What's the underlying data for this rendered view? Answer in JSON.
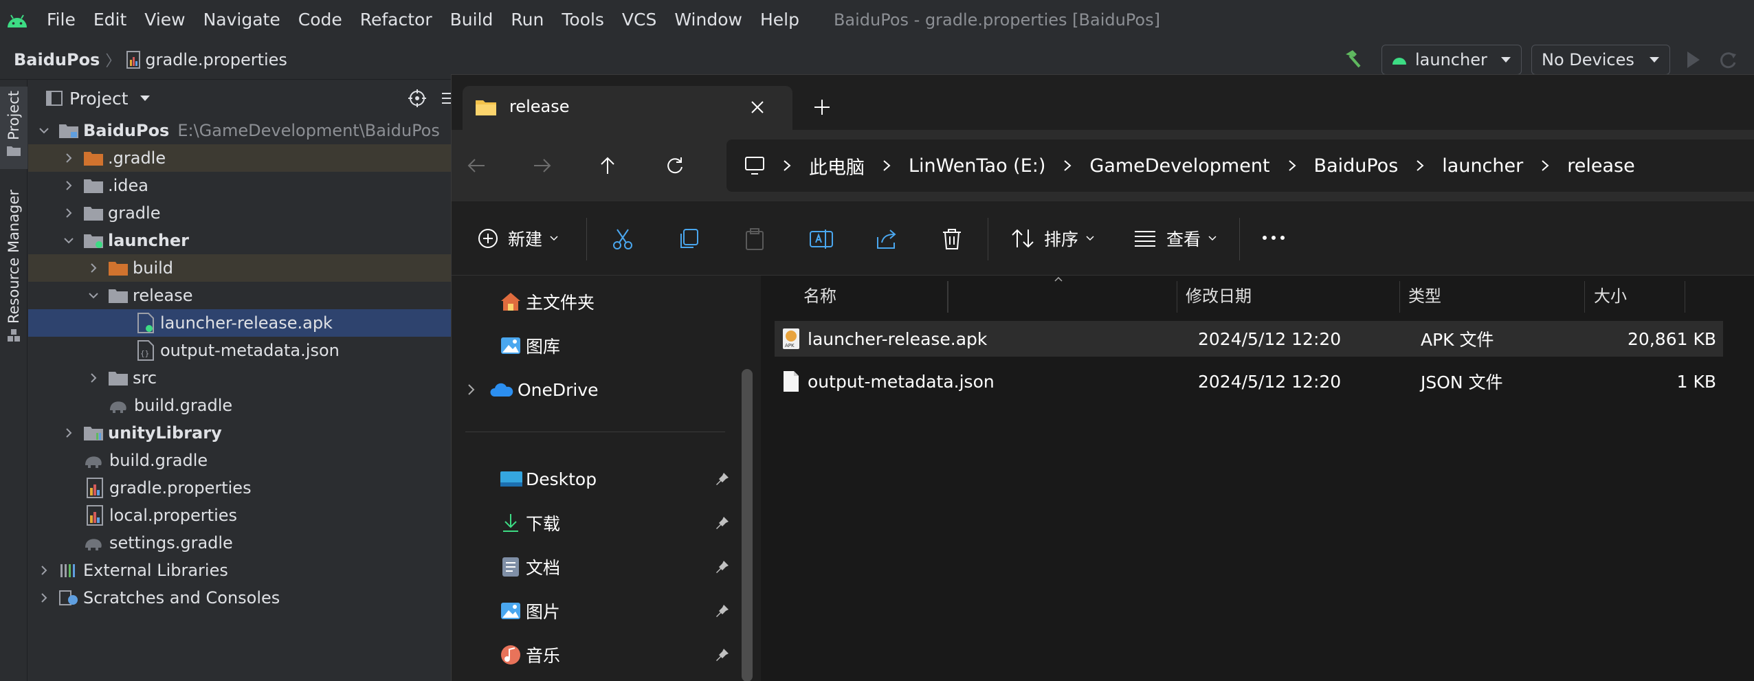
{
  "ide": {
    "title": "BaiduPos - gradle.properties [BaiduPos]",
    "menu": [
      "File",
      "Edit",
      "View",
      "Navigate",
      "Code",
      "Refactor",
      "Build",
      "Run",
      "Tools",
      "VCS",
      "Window",
      "Help"
    ],
    "breadcrumb": {
      "project": "BaiduPos",
      "file": "gradle.properties"
    },
    "run_config": "launcher",
    "device": "No Devices",
    "toolstrip": {
      "project": "Project",
      "resource_manager": "Resource Manager"
    },
    "project_panel": {
      "title": "Project",
      "tree": [
        {
          "label": "BaiduPos",
          "extra": "E:\\GameDevelopment\\BaiduPos",
          "bold": true
        },
        {
          "label": ".gradle"
        },
        {
          "label": ".idea"
        },
        {
          "label": "gradle"
        },
        {
          "label": "launcher",
          "bold": true
        },
        {
          "label": "build"
        },
        {
          "label": "release"
        },
        {
          "label": "launcher-release.apk"
        },
        {
          "label": "output-metadata.json"
        },
        {
          "label": "src"
        },
        {
          "label": "build.gradle"
        },
        {
          "label": "unityLibrary",
          "bold": true
        },
        {
          "label": "build.gradle"
        },
        {
          "label": "gradle.properties"
        },
        {
          "label": "local.properties"
        },
        {
          "label": "settings.gradle"
        },
        {
          "label": "External Libraries"
        },
        {
          "label": "Scratches and Consoles"
        }
      ]
    }
  },
  "explorer": {
    "tab_title": "release",
    "breadcrumbs": [
      "此电脑",
      "LinWenTao (E:)",
      "GameDevelopment",
      "BaiduPos",
      "launcher",
      "release"
    ],
    "toolbar": {
      "new": "新建",
      "sort": "排序",
      "view": "查看"
    },
    "sidebar": {
      "home": "主文件夹",
      "gallery": "图库",
      "onedrive": "OneDrive",
      "desktop": "Desktop",
      "downloads": "下载",
      "documents": "文档",
      "pictures": "图片",
      "music": "音乐"
    },
    "columns": {
      "name": "名称",
      "modified": "修改日期",
      "type": "类型",
      "size": "大小"
    },
    "files": [
      {
        "name": "launcher-release.apk",
        "modified": "2024/5/12 12:20",
        "type": "APK 文件",
        "size": "20,861 KB"
      },
      {
        "name": "output-metadata.json",
        "modified": "2024/5/12 12:20",
        "type": "JSON 文件",
        "size": "1 KB"
      }
    ]
  }
}
